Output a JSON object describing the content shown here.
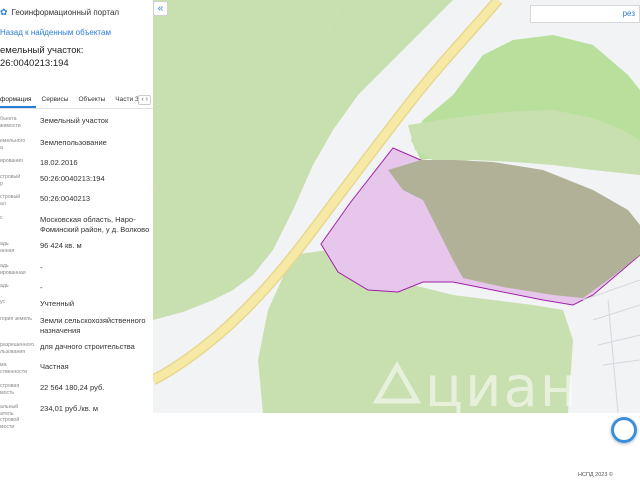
{
  "portal": {
    "title": "Геоинформационный портал"
  },
  "nav": {
    "back_link": "Назад к найденным объектам"
  },
  "object": {
    "heading_line1": "емельный участок:",
    "heading_line2": "26:0040213:194"
  },
  "tabs": [
    {
      "label": "формация",
      "active": true
    },
    {
      "label": "Сервисы",
      "active": false
    },
    {
      "label": "Объекты",
      "active": false
    },
    {
      "label": "Части ЗУ",
      "active": false
    }
  ],
  "tabs_scroll_icon": "chevron-left-right-icon",
  "rows": [
    {
      "label": "бъекта\nжимости",
      "value": "Земельный участок"
    },
    {
      "label": "емельного\nа",
      "value": "Землепользование"
    },
    {
      "label": "ирования",
      "value": "18.02.2016"
    },
    {
      "label": "стровый\nр",
      "value": "50:26:0040213:194"
    },
    {
      "label": "стровый\nал",
      "value": "50:26:0040213"
    },
    {
      "label": "с",
      "value": "Московская область, Наро-Фоминский район, у д. Волково"
    },
    {
      "label": "адь\nанная",
      "value": "96 424 кв. м"
    },
    {
      "label": "адь\nированная",
      "value": "-"
    },
    {
      "label": "адь",
      "value": "-"
    },
    {
      "label": "ус",
      "value": "Учтенный"
    },
    {
      "label": "гория земель",
      "value": "Земли сельскохозяйственного назначения"
    },
    {
      "label": "разрешенного\nльзования",
      "value": "для дачного строительства"
    },
    {
      "label": "ма\nственности",
      "value": "Частная"
    },
    {
      "label": "стровая\nмость",
      "value": "22 564 180,24 руб."
    },
    {
      "label": "альный\nатель\nстровой\nмости",
      "value": "234,01 руб./кв. м"
    }
  ],
  "map": {
    "collapse_label": "«",
    "search_text": "рез",
    "watermark": "циан",
    "colors": {
      "forest": "#c8dfb0",
      "light_field": "#b8e09c",
      "parcel_fill": "#e6c6ea",
      "parcel_stroke": "#a020a8",
      "road": "#f6e9a5",
      "overlap": "#b1b197"
    }
  },
  "footer": {
    "text": "НСПД 2023 ©"
  }
}
